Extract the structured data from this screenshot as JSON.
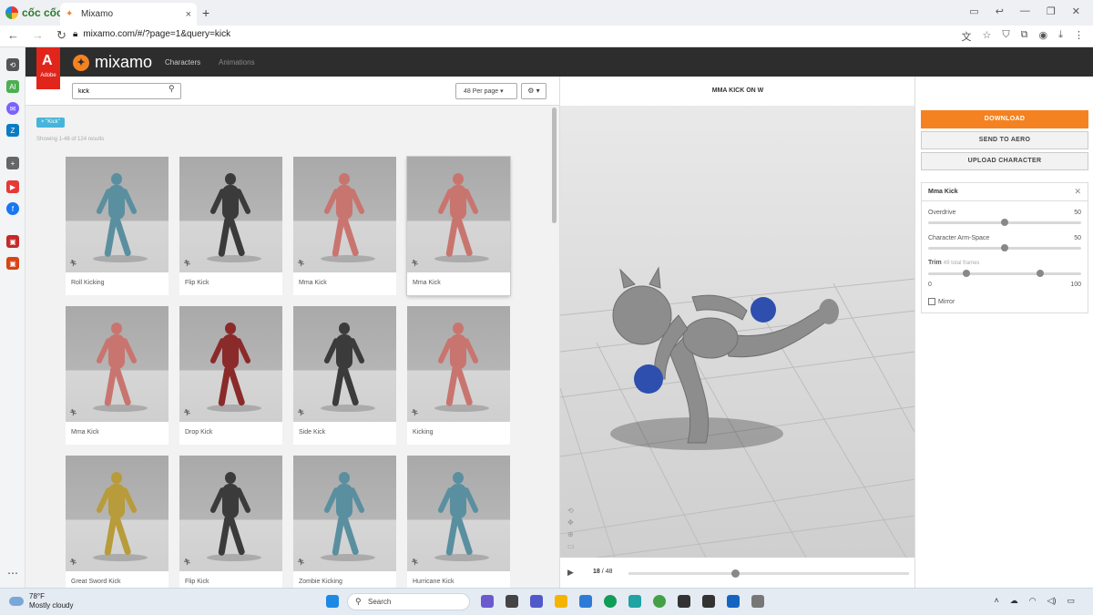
{
  "browser": {
    "brand": "cốc cốc",
    "tab_title": "Mixamo",
    "url": "mixamo.com/#/?page=1&query=kick",
    "new_tab": "+",
    "tab_close": "×"
  },
  "mixamo": {
    "adobe_label": "Adobe",
    "logo_text": "mixamo",
    "nav_characters": "Characters",
    "nav_animations": "Animations"
  },
  "search": {
    "value": "kick",
    "per_page": "48 Per page",
    "filter_chip": "× \"Kick\"",
    "results_text": "Showing 1-48 of 124 results"
  },
  "cards": [
    {
      "label": "Roll Kicking",
      "color": "#5a8fa0"
    },
    {
      "label": "Flip Kick",
      "color": "#3b3b3b"
    },
    {
      "label": "Mma Kick",
      "color": "#c9756f"
    },
    {
      "label": "Mma Kick",
      "color": "#c9756f"
    },
    {
      "label": "Mma Kick",
      "color": "#c9756f"
    },
    {
      "label": "Drop Kick",
      "color": "#8b2a2a"
    },
    {
      "label": "Side Kick",
      "color": "#3b3b3b"
    },
    {
      "label": "Kicking",
      "color": "#c9756f"
    },
    {
      "label": "Great Sword Kick",
      "color": "#b89b3a"
    },
    {
      "label": "Flip Kick",
      "color": "#3b3b3b"
    },
    {
      "label": "Zombie Kicking",
      "color": "#5a8fa0"
    },
    {
      "label": "Hurricane Kick",
      "color": "#5a8fa0"
    }
  ],
  "viewer": {
    "title": "MMA KICK ON W",
    "current_frame": "18",
    "total_frames": "48",
    "progress": 0.38
  },
  "panel": {
    "download": "DOWNLOAD",
    "send_to_aero": "SEND TO AERO",
    "upload_character": "UPLOAD CHARACTER",
    "settings_title": "Mma Kick",
    "overdrive_label": "Overdrive",
    "overdrive_value": "50",
    "overdrive_level": 0.5,
    "armspace_label": "Character Arm-Space",
    "armspace_value": "50",
    "armspace_level": 0.5,
    "trim_label": "Trim",
    "trim_note": "49 total frames",
    "trim_min": "0",
    "trim_max": "100",
    "trim_start": 0.25,
    "trim_end": 0.73,
    "mirror_label": "Mirror"
  },
  "taskbar": {
    "temperature": "78°F",
    "weather": "Mostly cloudy",
    "search_placeholder": "Search"
  },
  "colors": {
    "accent": "#f58220",
    "chip": "#46b5d9",
    "header": "#2d2d2d"
  }
}
